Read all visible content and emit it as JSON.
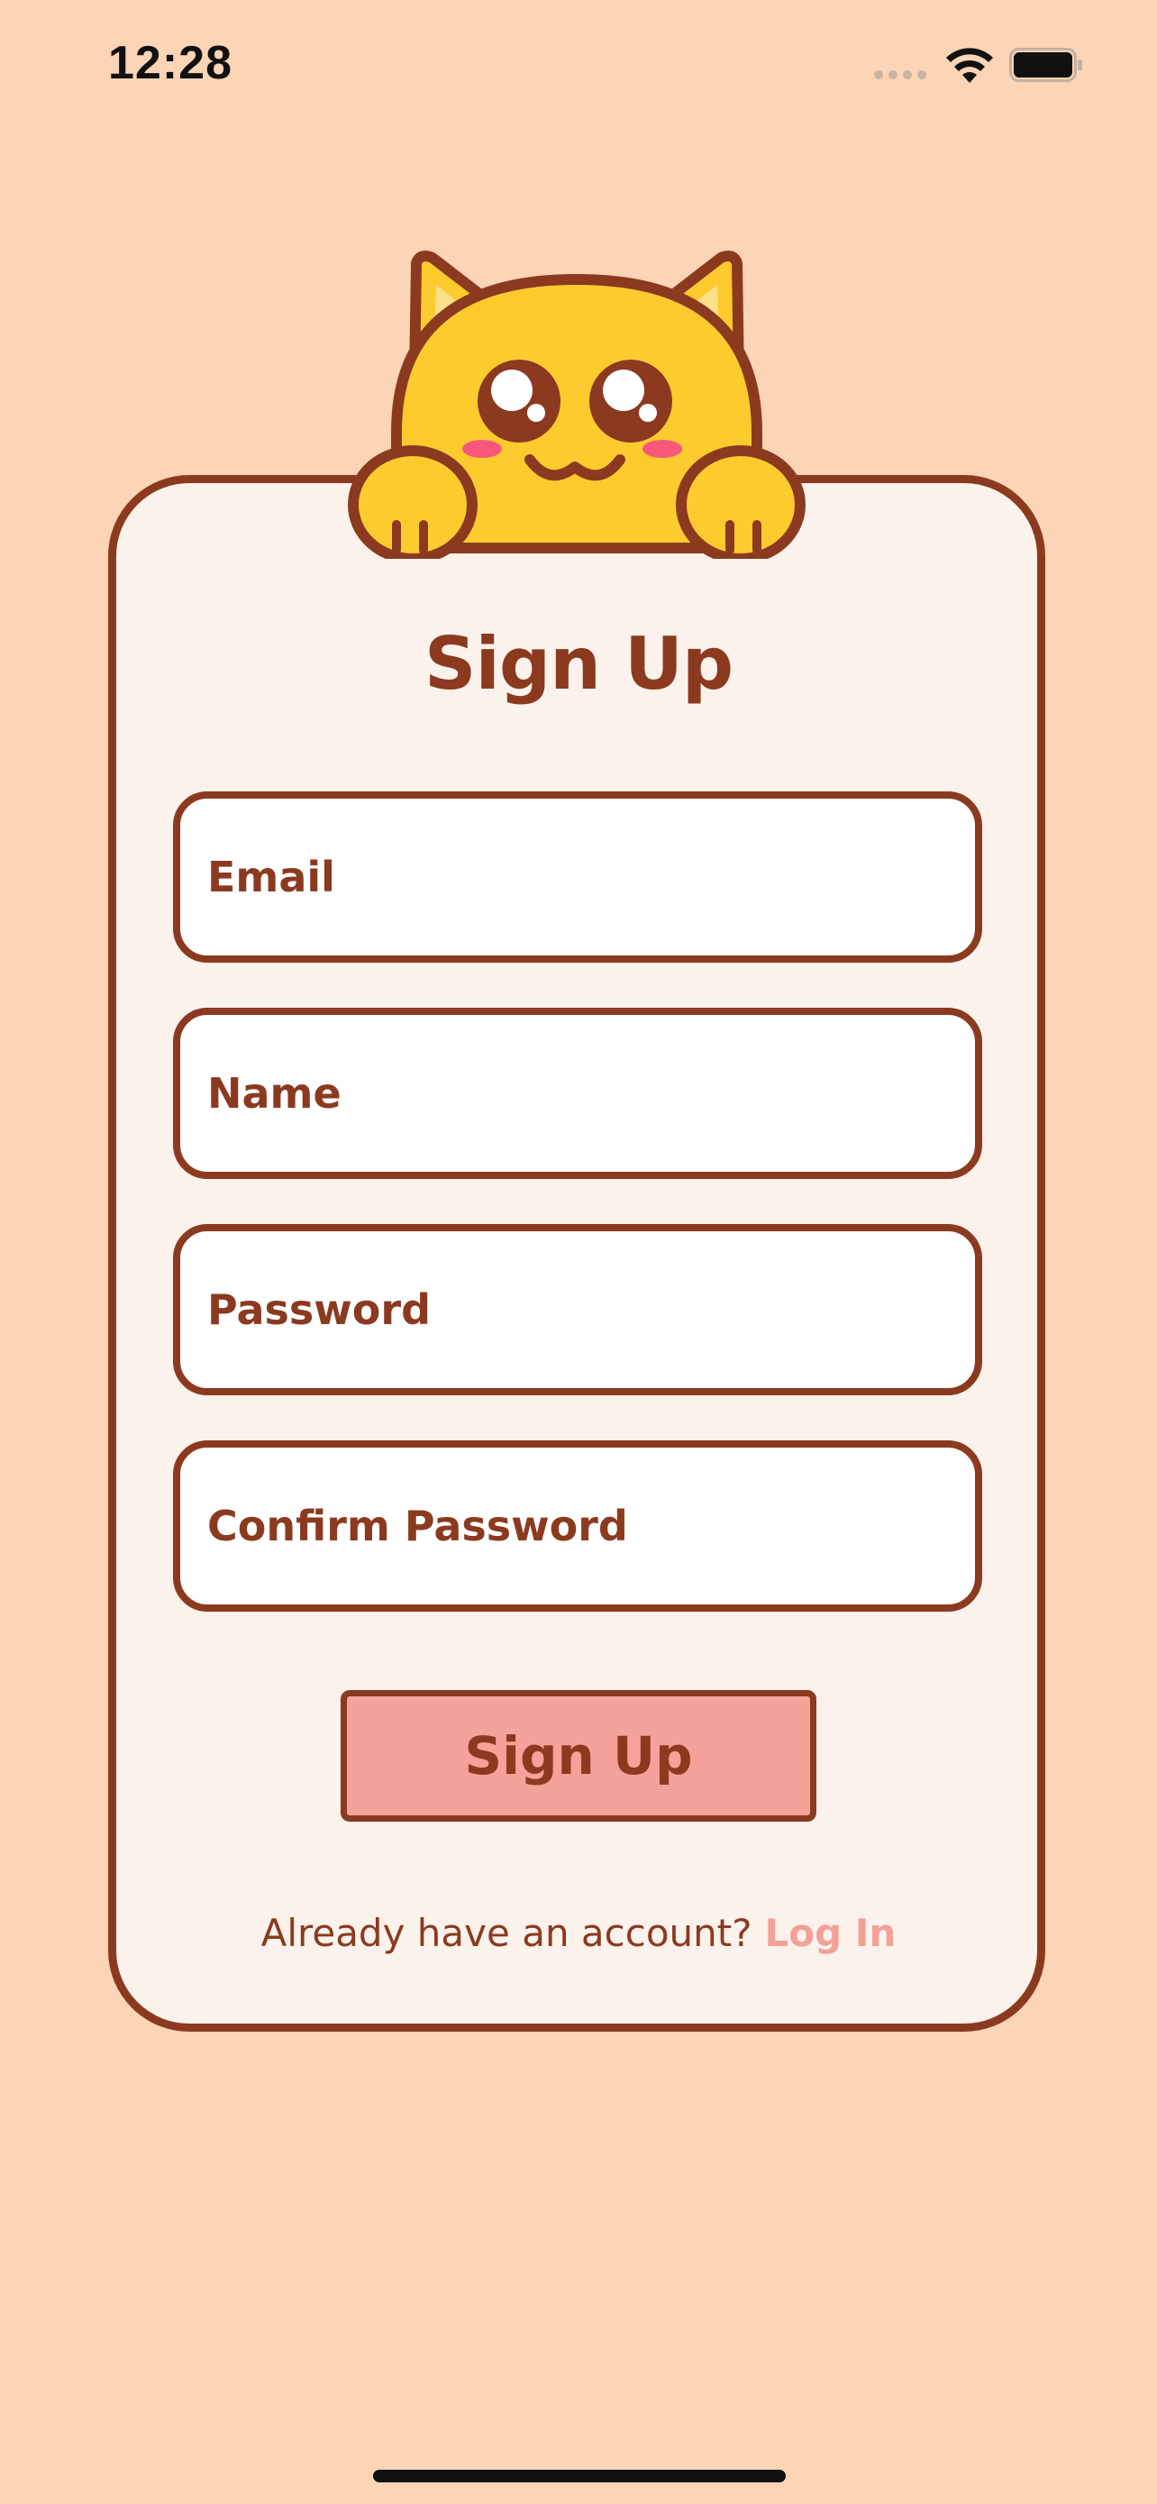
{
  "status_bar": {
    "time": "12:28",
    "icons": [
      "signal-icon",
      "wifi-icon",
      "battery-icon"
    ]
  },
  "mascot": {
    "icon": "cat-mascot-icon"
  },
  "form": {
    "title": "Sign Up",
    "fields": [
      {
        "placeholder": "Email",
        "value": ""
      },
      {
        "placeholder": "Name",
        "value": ""
      },
      {
        "placeholder": "Password",
        "value": ""
      },
      {
        "placeholder": "Confirm Password",
        "value": ""
      }
    ],
    "submit_label": "Sign Up"
  },
  "footer": {
    "prompt": "Already have an account?",
    "link_label": "Log In"
  },
  "colors": {
    "background": "#fbd5b5",
    "card": "#fbf2ec",
    "accent": "#8b3a20",
    "button": "#f4a39a",
    "link": "#f3a097",
    "cat_body": "#fdcb2e"
  }
}
